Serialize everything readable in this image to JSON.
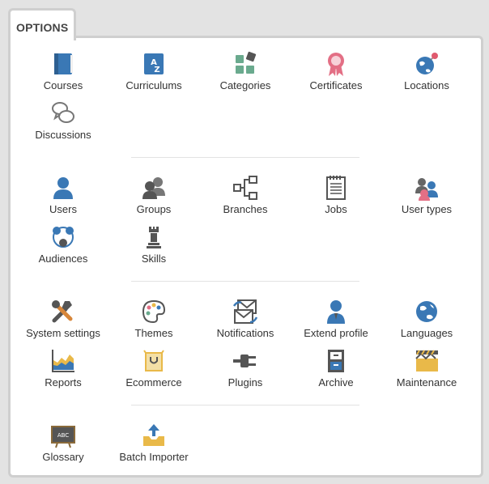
{
  "tab": {
    "label": "OPTIONS"
  },
  "items": [
    {
      "label": "Courses",
      "icon": "book-icon"
    },
    {
      "label": "Curriculums",
      "icon": "az-book-icon"
    },
    {
      "label": "Categories",
      "icon": "categories-icon"
    },
    {
      "label": "Certificates",
      "icon": "ribbon-icon"
    },
    {
      "label": "Locations",
      "icon": "globe-pin-icon"
    },
    {
      "label": "Discussions",
      "icon": "speech-bubbles-icon"
    },
    {
      "label": "Users",
      "icon": "user-icon"
    },
    {
      "label": "Groups",
      "icon": "group-icon"
    },
    {
      "label": "Branches",
      "icon": "tree-branches-icon"
    },
    {
      "label": "Jobs",
      "icon": "notepad-icon"
    },
    {
      "label": "User types",
      "icon": "user-types-icon"
    },
    {
      "label": "Audiences",
      "icon": "audience-icon"
    },
    {
      "label": "Skills",
      "icon": "chess-rook-icon"
    },
    {
      "label": "System settings",
      "icon": "tools-icon"
    },
    {
      "label": "Themes",
      "icon": "palette-icon"
    },
    {
      "label": "Notifications",
      "icon": "envelope-icon"
    },
    {
      "label": "Extend profile",
      "icon": "profile-icon"
    },
    {
      "label": "Languages",
      "icon": "globe-icon"
    },
    {
      "label": "Reports",
      "icon": "chart-icon"
    },
    {
      "label": "Ecommerce",
      "icon": "shopping-bag-icon"
    },
    {
      "label": "Plugins",
      "icon": "plug-icon"
    },
    {
      "label": "Archive",
      "icon": "archive-icon"
    },
    {
      "label": "Maintenance",
      "icon": "maintenance-icon"
    },
    {
      "label": "Glossary",
      "icon": "blackboard-icon"
    },
    {
      "label": "Batch Importer",
      "icon": "upload-tray-icon"
    }
  ],
  "icon_board_text": "ABC",
  "colors": {
    "blue": "#3a78b5",
    "green": "#6aaa8e",
    "pink": "#e36f85",
    "gray": "#5b5b5b",
    "gold": "#e9b949"
  }
}
